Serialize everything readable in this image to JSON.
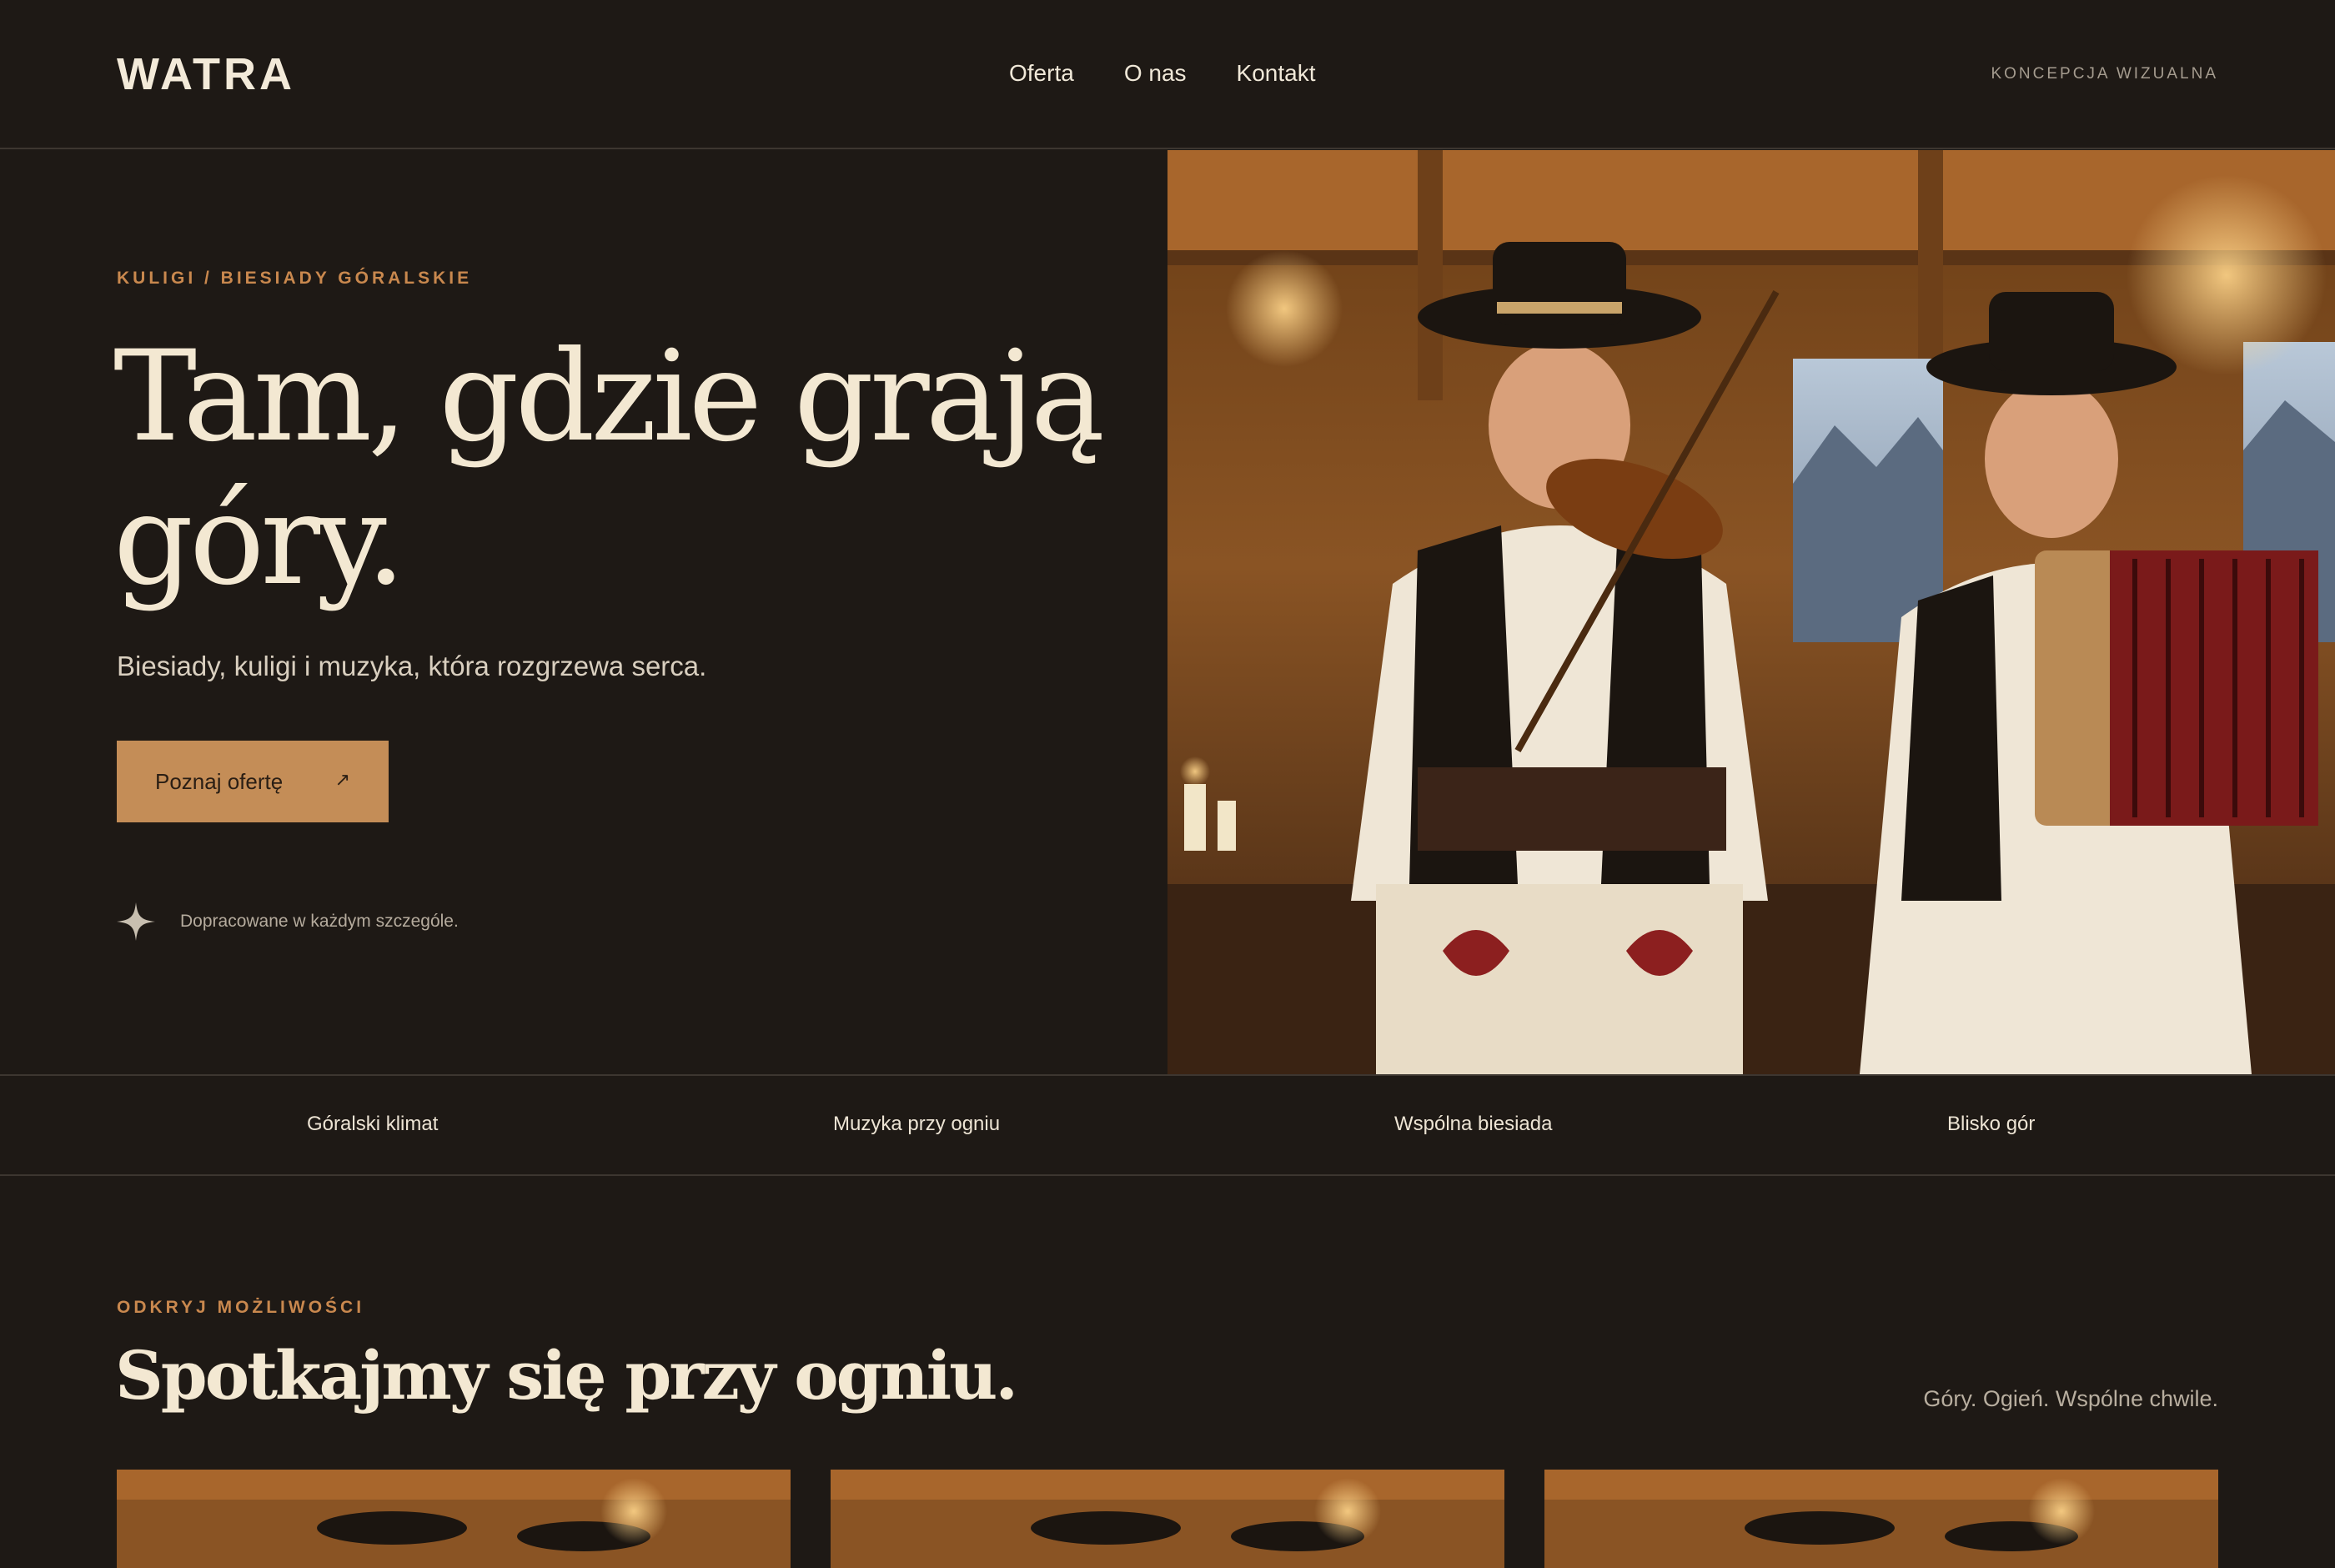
{
  "header": {
    "logo": "WATRA",
    "nav": [
      "Oferta",
      "O nas",
      "Kontakt"
    ],
    "tag": "KONCEPCJA WIZUALNA"
  },
  "hero": {
    "eyebrow": "KULIGI / BIESIADY GÓRALSKIE",
    "title_line1": "Tam, gdzie grają",
    "title_line2": "góry.",
    "subtitle": "Biesiady, kuligi i muzyka, która rozgrzewa serca.",
    "cta_label": "Poznaj ofertę",
    "cta_arrow": "↗",
    "note": "Dopracowane w każdym szczególe."
  },
  "features": [
    "Góralski klimat",
    "Muzyka przy ogniu",
    "Wspólna biesiada",
    "Blisko gór"
  ],
  "section": {
    "eyebrow": "ODKRYJ MOŻLIWOŚCI",
    "title": "Spotkajmy się przy ogniu.",
    "aside": "Góry. Ogień. Wspólne chwile."
  },
  "colors": {
    "background": "#1e1915",
    "accent": "#c48d57",
    "eyebrow": "#c9884e",
    "heading": "#f3e8d2"
  },
  "icons": {
    "note": "sparkle-icon",
    "cta": "arrow-up-right-icon"
  }
}
